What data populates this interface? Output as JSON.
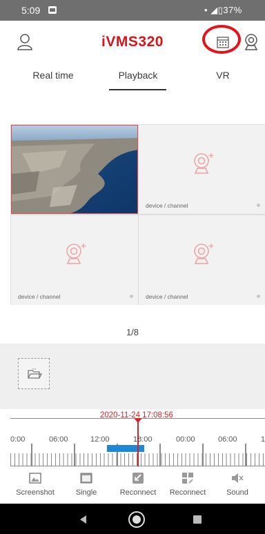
{
  "status_bar": {
    "time": "5:09",
    "right_text": "•  ◢▯37%"
  },
  "header": {
    "title": "iVMS320"
  },
  "tabs": [
    {
      "label": "Real time"
    },
    {
      "label": "Playback"
    },
    {
      "label": "VR"
    }
  ],
  "grid": {
    "cells": [
      {
        "label": "device / channel"
      },
      {
        "label": "device / channel"
      },
      {
        "label": "device / channel"
      }
    ]
  },
  "pager": {
    "text": "1/8"
  },
  "timeline": {
    "current_time": "2020-11-24 17:08:56",
    "ticks": [
      "0:00",
      "06:00",
      "12:00",
      "18:00",
      "00:00",
      "06:00",
      "1"
    ]
  },
  "toolbar": [
    {
      "label": "Screenshot",
      "icon": "screenshot-icon"
    },
    {
      "label": "Single",
      "icon": "single-view-icon"
    },
    {
      "label": "Reconnect",
      "icon": "reconnect-icon"
    },
    {
      "label": "Reconnect",
      "icon": "reconnect-all-icon"
    },
    {
      "label": "Sound",
      "icon": "sound-muted-icon"
    }
  ],
  "colors": {
    "brand": "#d7131b",
    "highlight": "#e8101c",
    "record_bar": "#1e88d8",
    "cursor": "#d4242a"
  }
}
